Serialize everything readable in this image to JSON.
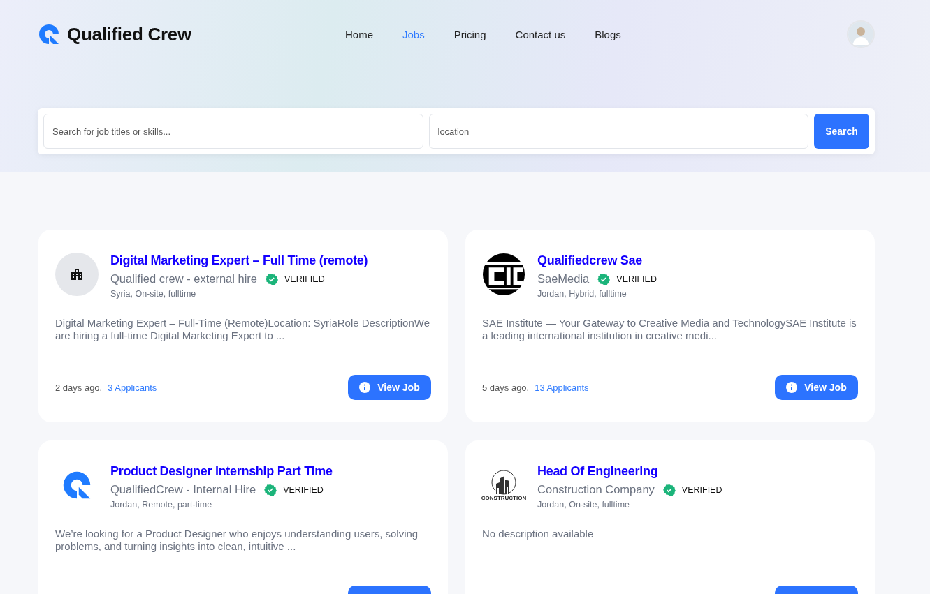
{
  "brand": {
    "name": "Qualified Crew"
  },
  "nav": [
    {
      "label": "Home",
      "selected": false
    },
    {
      "label": "Jobs",
      "selected": true
    },
    {
      "label": "Pricing",
      "selected": false
    },
    {
      "label": "Contact us",
      "selected": false
    },
    {
      "label": "Blogs",
      "selected": false
    }
  ],
  "search": {
    "query_placeholder": "Search for job titles or skills...",
    "location_placeholder": "location",
    "button": "Search"
  },
  "jobs": [
    {
      "logo": {
        "kind": "building"
      },
      "title": "Digital Marketing Expert – Full Time (remote)",
      "company": "Qualified crew - external hire",
      "verified": true,
      "badge": "VERIFIED",
      "location": "Syria, On-site, fulltime",
      "description": "Digital Marketing Expert – Full-Time (Remote)Location: SyriaRole DescriptionWe are hiring a full-time Digital Marketing Expert to ...",
      "posted": "2 days ago,",
      "applicants": "3 Applicants",
      "view_button": {
        "label": "View Job",
        "cut": false
      }
    },
    {
      "logo": {
        "kind": "stripes"
      },
      "title": "Qualifiedcrew Sae",
      "company": "SaeMedia",
      "verified": true,
      "badge": "VERIFIED",
      "location": "Jordan, Hybrid, fulltime",
      "description": "SAE Institute — Your Gateway to Creative Media and TechnologySAE Institute is a leading international institution in creative medi...",
      "posted": "5 days ago,",
      "applicants": "13 Applicants",
      "view_button": {
        "label": "View Job",
        "cut": false
      }
    },
    {
      "logo": {
        "kind": "brand"
      },
      "title": "Product Designer Internship Part Time",
      "company": "QualifiedCrew - Internal Hire",
      "verified": true,
      "badge": "VERIFIED",
      "location": "Jordan, Remote, part-time",
      "description": "We’re looking for a Product Designer who enjoys understanding users, solving problems, and turning insights into clean, intuitive ...",
      "view_button": {
        "cut": true
      }
    },
    {
      "logo": {
        "kind": "construction",
        "text": "CONSTRUCTION"
      },
      "title": "Head Of Engineering",
      "company": "Construction Company",
      "verified": true,
      "badge": "VERIFIED",
      "location": "Jordan, On-site, fulltime",
      "description": "No description available",
      "view_button": {
        "cut": true
      }
    }
  ]
}
